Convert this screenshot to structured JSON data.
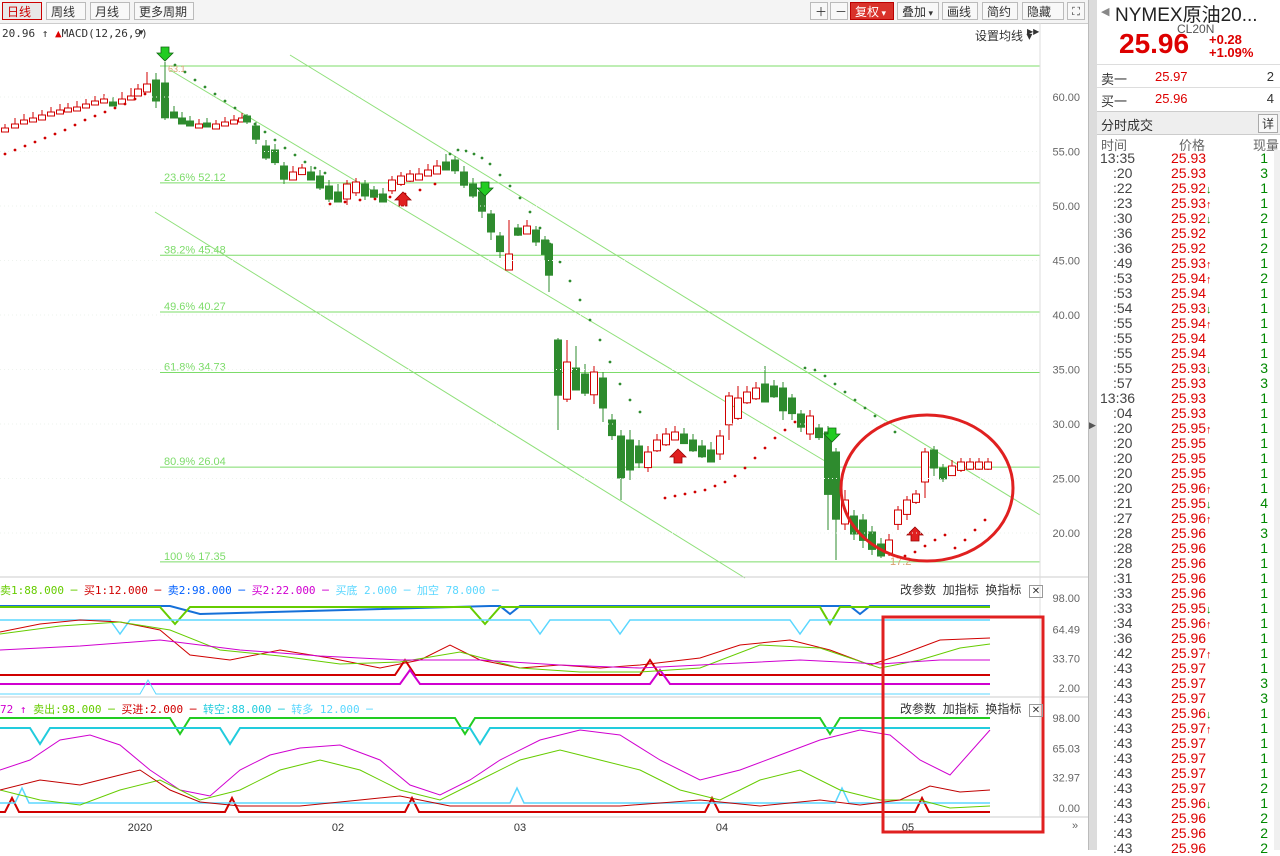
{
  "toolbar": {
    "tabs": [
      "日线",
      "周线",
      "月线",
      "更多周期"
    ],
    "right_buttons": [
      "＋",
      "－",
      "复权",
      "叠加",
      "画线",
      "简约",
      "隐藏"
    ],
    "expand_icon": "fullscreen-icon"
  },
  "main_chart": {
    "indicator_line": "20.96 ↑",
    "macd_label": "MACD(12,26,9)",
    "settings_label": "设置均线",
    "y_ticks": [
      "60.00",
      "55.00",
      "50.00",
      "45.00",
      "40.00",
      "35.00",
      "30.00",
      "25.00",
      "20.00"
    ],
    "fib_labels": [
      "23.6% 52.12",
      "38.2% 45.48",
      "49.6% 40.27",
      "61.8% 34.73",
      "80.9% 26.04",
      "100 % 17.35"
    ],
    "low_label": "17.2",
    "top_label": "63.1"
  },
  "panel1": {
    "legend": [
      {
        "text": "卖1:88.000",
        "color": "#66cc00"
      },
      {
        "text": "买1:12.000",
        "color": "#d00000"
      },
      {
        "text": "卖2:98.000",
        "color": "#0060ff"
      },
      {
        "text": "买2:22.000",
        "color": "#d000d0"
      },
      {
        "text": "买底 2.000",
        "color": "#5bd7ff"
      },
      {
        "text": "加空 78.000",
        "color": "#5bd7ff"
      }
    ],
    "buttons": [
      "改参数",
      "加指标",
      "换指标"
    ],
    "y_ticks": [
      "98.00",
      "64.49",
      "33.70",
      "2.00"
    ]
  },
  "panel2": {
    "prefix": "72 ↑",
    "legend": [
      {
        "text": "卖出:98.000",
        "color": "#66cc00"
      },
      {
        "text": "买进:2.000",
        "color": "#d00000"
      },
      {
        "text": "转空:88.000",
        "color": "#22ccdd"
      },
      {
        "text": "转多 12.000",
        "color": "#5bd7ff"
      }
    ],
    "buttons": [
      "改参数",
      "加指标",
      "换指标"
    ],
    "y_ticks": [
      "98.00",
      "65.03",
      "32.97",
      "0.00"
    ]
  },
  "x_axis": [
    "2020",
    "02",
    "03",
    "04",
    "05"
  ],
  "quote": {
    "name": "NYMEX原油20...",
    "code": "CL20N",
    "price": "25.96",
    "change": "+0.28",
    "change_pct": "+1.09%",
    "sell_label": "卖一",
    "sell_price": "25.97",
    "sell_vol": "2",
    "buy_label": "买一",
    "buy_price": "25.96",
    "buy_vol": "4",
    "ticks_title": "分时成交",
    "detail_btn": "详",
    "col_time": "时间",
    "col_price": "价格",
    "col_vol": "现量"
  },
  "ticks": [
    {
      "t": "13:35",
      "p": "25.93",
      "a": "",
      "v": "1"
    },
    {
      "t": ":20",
      "p": "25.93",
      "a": "",
      "v": "3"
    },
    {
      "t": ":22",
      "p": "25.92",
      "a": "dn",
      "v": "1"
    },
    {
      "t": ":23",
      "p": "25.93",
      "a": "up",
      "v": "1"
    },
    {
      "t": ":30",
      "p": "25.92",
      "a": "dn",
      "v": "2"
    },
    {
      "t": ":36",
      "p": "25.92",
      "a": "",
      "v": "1"
    },
    {
      "t": ":36",
      "p": "25.92",
      "a": "",
      "v": "2"
    },
    {
      "t": ":49",
      "p": "25.93",
      "a": "up",
      "v": "1"
    },
    {
      "t": ":53",
      "p": "25.94",
      "a": "up",
      "v": "2"
    },
    {
      "t": ":53",
      "p": "25.94",
      "a": "",
      "v": "1"
    },
    {
      "t": ":54",
      "p": "25.93",
      "a": "dn",
      "v": "1"
    },
    {
      "t": ":55",
      "p": "25.94",
      "a": "up",
      "v": "1"
    },
    {
      "t": ":55",
      "p": "25.94",
      "a": "",
      "v": "1"
    },
    {
      "t": ":55",
      "p": "25.94",
      "a": "",
      "v": "1"
    },
    {
      "t": ":55",
      "p": "25.93",
      "a": "dn",
      "v": "3"
    },
    {
      "t": ":57",
      "p": "25.93",
      "a": "",
      "v": "3"
    },
    {
      "t": "13:36",
      "p": "25.93",
      "a": "",
      "v": "1"
    },
    {
      "t": ":04",
      "p": "25.93",
      "a": "",
      "v": "1"
    },
    {
      "t": ":20",
      "p": "25.95",
      "a": "up",
      "v": "1"
    },
    {
      "t": ":20",
      "p": "25.95",
      "a": "",
      "v": "1"
    },
    {
      "t": ":20",
      "p": "25.95",
      "a": "",
      "v": "1"
    },
    {
      "t": ":20",
      "p": "25.95",
      "a": "",
      "v": "1"
    },
    {
      "t": ":20",
      "p": "25.96",
      "a": "up",
      "v": "1"
    },
    {
      "t": ":21",
      "p": "25.95",
      "a": "dn",
      "v": "4"
    },
    {
      "t": ":27",
      "p": "25.96",
      "a": "up",
      "v": "1"
    },
    {
      "t": ":28",
      "p": "25.96",
      "a": "",
      "v": "3"
    },
    {
      "t": ":28",
      "p": "25.96",
      "a": "",
      "v": "1"
    },
    {
      "t": ":28",
      "p": "25.96",
      "a": "",
      "v": "1"
    },
    {
      "t": ":31",
      "p": "25.96",
      "a": "",
      "v": "1"
    },
    {
      "t": ":33",
      "p": "25.96",
      "a": "",
      "v": "1"
    },
    {
      "t": ":33",
      "p": "25.95",
      "a": "dn",
      "v": "1"
    },
    {
      "t": ":34",
      "p": "25.96",
      "a": "up",
      "v": "1"
    },
    {
      "t": ":36",
      "p": "25.96",
      "a": "",
      "v": "1"
    },
    {
      "t": ":42",
      "p": "25.97",
      "a": "up",
      "v": "1"
    },
    {
      "t": ":43",
      "p": "25.97",
      "a": "",
      "v": "1"
    },
    {
      "t": ":43",
      "p": "25.97",
      "a": "",
      "v": "3"
    },
    {
      "t": ":43",
      "p": "25.97",
      "a": "",
      "v": "3"
    },
    {
      "t": ":43",
      "p": "25.96",
      "a": "dn",
      "v": "1"
    },
    {
      "t": ":43",
      "p": "25.97",
      "a": "up",
      "v": "1"
    },
    {
      "t": ":43",
      "p": "25.97",
      "a": "",
      "v": "1"
    },
    {
      "t": ":43",
      "p": "25.97",
      "a": "",
      "v": "1"
    },
    {
      "t": ":43",
      "p": "25.97",
      "a": "",
      "v": "1"
    },
    {
      "t": ":43",
      "p": "25.97",
      "a": "",
      "v": "2"
    },
    {
      "t": ":43",
      "p": "25.96",
      "a": "dn",
      "v": "1"
    },
    {
      "t": ":43",
      "p": "25.96",
      "a": "",
      "v": "2"
    },
    {
      "t": ":43",
      "p": "25.96",
      "a": "",
      "v": "2"
    },
    {
      "t": ":43",
      "p": "25.96",
      "a": "",
      "v": "2"
    }
  ],
  "colors": {
    "up": "#d00000",
    "down": "#2e8b2e",
    "fib": "#7ddc6a",
    "channel": "#7ddc6a",
    "highlight": "#e02020"
  }
}
